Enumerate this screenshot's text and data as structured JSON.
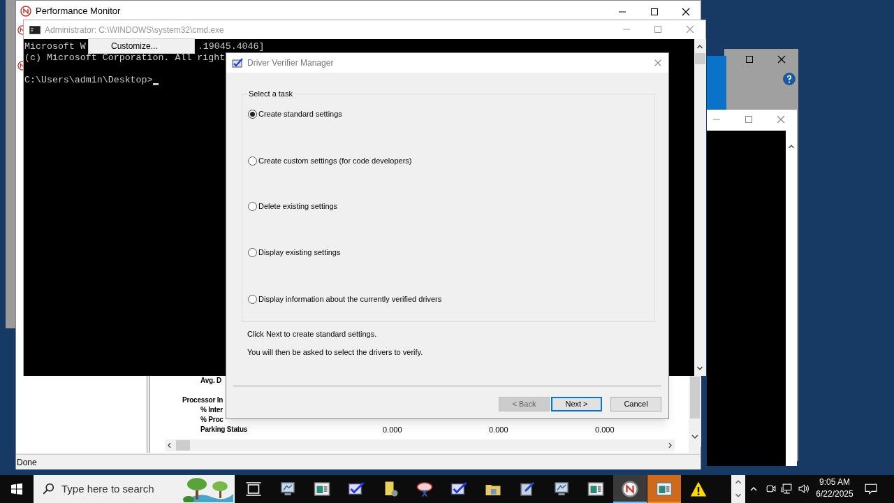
{
  "perf_monitor": {
    "title": "Performance Monitor",
    "rows": [
      {
        "label": "Avg. D",
        "kind": "counter",
        "values": []
      },
      {
        "label": "Processor In",
        "kind": "object",
        "values": []
      },
      {
        "label": "% Inter",
        "kind": "counter",
        "values": []
      },
      {
        "label": "% Proc",
        "kind": "counter",
        "values": []
      },
      {
        "label": "Parking Status",
        "kind": "counter",
        "values": [
          "0.000",
          "0.000",
          "0.000"
        ]
      }
    ],
    "status": "Done"
  },
  "cmd": {
    "title": "Administrator: C:\\WINDOWS\\system32\\cmd.exe",
    "lines": [
      [
        "Microsoft W",
        ".19045.4046]"
      ],
      [
        "(c) Microsoft Corporation. All right"
      ],
      [
        "C:\\Users\\admin\\Desktop>"
      ]
    ],
    "context_menu": [
      "Customize..."
    ]
  },
  "dialog": {
    "title": "Driver Verifier Manager",
    "group_label": "Select a task",
    "options": [
      {
        "label": "Create standard settings",
        "selected": true
      },
      {
        "label": "Create custom settings (for code developers)",
        "selected": false
      },
      {
        "label": "Delete existing settings",
        "selected": false
      },
      {
        "label": "Display existing settings",
        "selected": false
      },
      {
        "label": "Display information about the currently verified drivers",
        "selected": false
      }
    ],
    "info": [
      "Click Next to create standard settings.",
      "You will then be asked to select the drivers to verify."
    ],
    "buttons": [
      {
        "label": "< Back",
        "disabled": true,
        "default": false
      },
      {
        "label": "Next >",
        "disabled": false,
        "default": true
      },
      {
        "label": "Cancel",
        "disabled": false,
        "default": false
      }
    ]
  },
  "taskbar": {
    "search_placeholder": "Type here to search",
    "apps": [
      {
        "kind": "task-view",
        "open": false,
        "flashing": false
      },
      {
        "kind": "monitor",
        "open": false,
        "flashing": false
      },
      {
        "kind": "panel",
        "open": false,
        "flashing": false
      },
      {
        "kind": "check",
        "open": false,
        "flashing": false
      },
      {
        "kind": "doc",
        "open": false,
        "flashing": false
      },
      {
        "kind": "scissors",
        "open": false,
        "flashing": false
      },
      {
        "kind": "check",
        "open": false,
        "flashing": false
      },
      {
        "kind": "folder",
        "open": false,
        "flashing": false
      },
      {
        "kind": "pen",
        "open": false,
        "flashing": false
      },
      {
        "kind": "monitor",
        "open": false,
        "flashing": false
      },
      {
        "kind": "panel",
        "open": false,
        "flashing": false
      },
      {
        "kind": "gauge",
        "open": true,
        "flashing": false
      },
      {
        "kind": "panel",
        "open": false,
        "flashing": true
      },
      {
        "kind": "warning",
        "open": false,
        "flashing": false
      }
    ],
    "time": "9:05 AM",
    "date": "6/22/2025"
  }
}
